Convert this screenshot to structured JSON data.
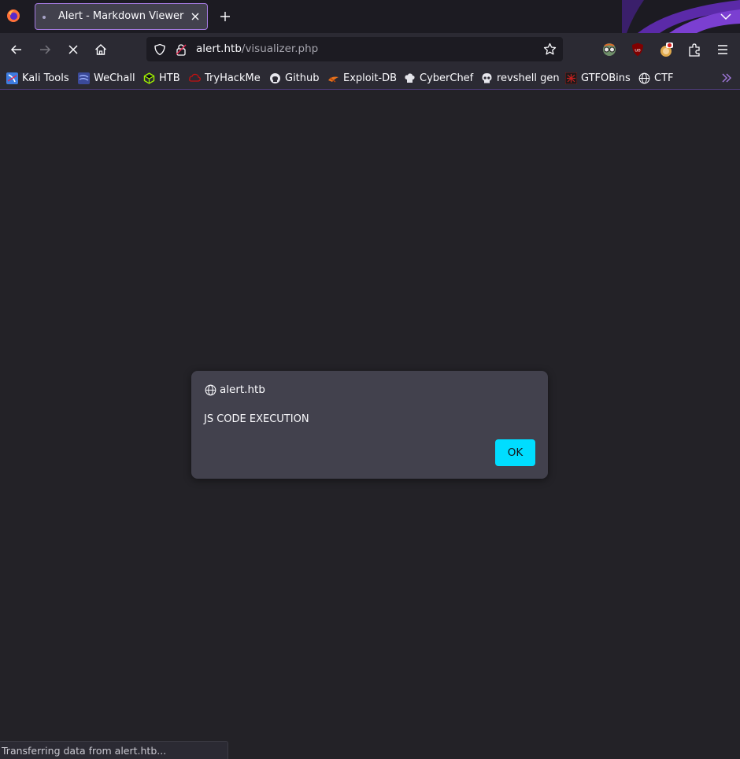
{
  "browser": {
    "tab": {
      "title": "Alert - Markdown Viewer"
    },
    "url": {
      "host": "alert.htb",
      "path": "/visualizer.php"
    },
    "accent_color": "#a47ae0",
    "icons": [
      "firefox-logo",
      "close-icon",
      "plus-icon",
      "chevron-down-icon",
      "back-arrow-icon",
      "forward-arrow-icon",
      "stop-icon",
      "home-icon",
      "shield-icon",
      "lock-icon",
      "star-icon",
      "extension-icon",
      "ublock-icon",
      "menu-icon",
      "double-chevron-icon"
    ]
  },
  "bookmarks": [
    {
      "label": "Kali Tools"
    },
    {
      "label": "WeChall"
    },
    {
      "label": "HTB"
    },
    {
      "label": "TryHackMe"
    },
    {
      "label": "Github"
    },
    {
      "label": "Exploit-DB"
    },
    {
      "label": "CyberChef"
    },
    {
      "label": "revshell gen"
    },
    {
      "label": "GTFOBins"
    },
    {
      "label": "CTF"
    }
  ],
  "dialog": {
    "origin": "alert.htb",
    "message": "JS CODE EXECUTION",
    "ok_label": "OK",
    "button_color": "#00ddff"
  },
  "status": {
    "text": "Transferring data from alert.htb..."
  }
}
